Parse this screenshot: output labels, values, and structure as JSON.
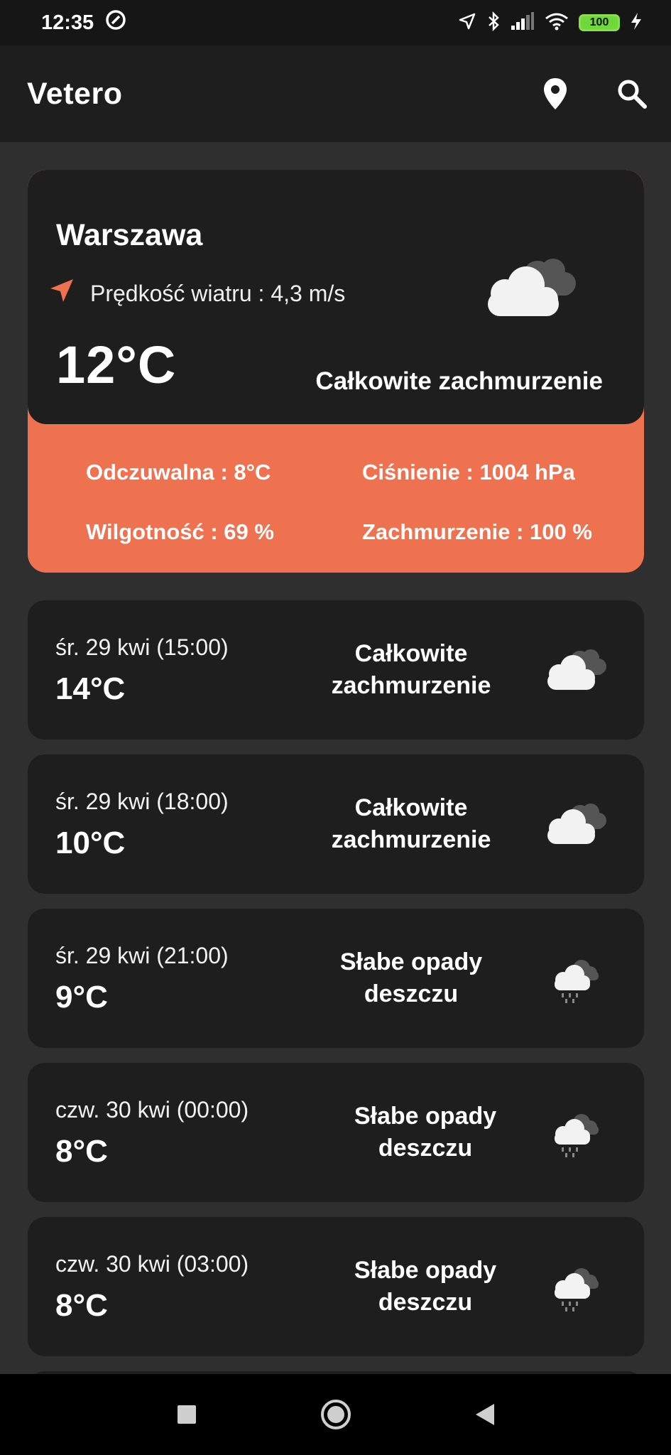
{
  "status_bar": {
    "time": "12:35",
    "battery": "100",
    "icons": [
      "at-sign-icon",
      "location-arrow-icon",
      "bluetooth-icon",
      "signal-icon",
      "wifi-icon",
      "battery-icon",
      "charging-bolt-icon"
    ]
  },
  "app_bar": {
    "title": "Vetero",
    "actions": [
      "location-pin-icon",
      "search-icon"
    ]
  },
  "current": {
    "city": "Warszawa",
    "wind": "Prędkość wiatru : 4,3 m/s",
    "temperature": "12°C",
    "description": "Całkowite zachmurzenie",
    "icon": "overcast-cloud-icon",
    "details": {
      "feels_like": "Odczuwalna : 8°C",
      "pressure": "Ciśnienie : 1004 hPa",
      "humidity": "Wilgotność : 69 %",
      "cloudiness": "Zachmurzenie : 100 %"
    }
  },
  "forecast": [
    {
      "date": "śr. 29 kwi (15:00)",
      "temp": "14°C",
      "desc": "Całkowite zachmurzenie",
      "icon": "overcast-cloud-icon"
    },
    {
      "date": "śr. 29 kwi (18:00)",
      "temp": "10°C",
      "desc": "Całkowite zachmurzenie",
      "icon": "overcast-cloud-icon"
    },
    {
      "date": "śr. 29 kwi (21:00)",
      "temp": "9°C",
      "desc": "Słabe opady deszczu",
      "icon": "light-rain-icon"
    },
    {
      "date": "czw. 30 kwi (00:00)",
      "temp": "8°C",
      "desc": "Słabe opady deszczu",
      "icon": "light-rain-icon"
    },
    {
      "date": "czw. 30 kwi (03:00)",
      "temp": "8°C",
      "desc": "Słabe opady deszczu",
      "icon": "light-rain-icon"
    }
  ],
  "colors": {
    "background": "#2f2f2f",
    "card": "#1e1e1e",
    "accent": "#ee7150"
  }
}
